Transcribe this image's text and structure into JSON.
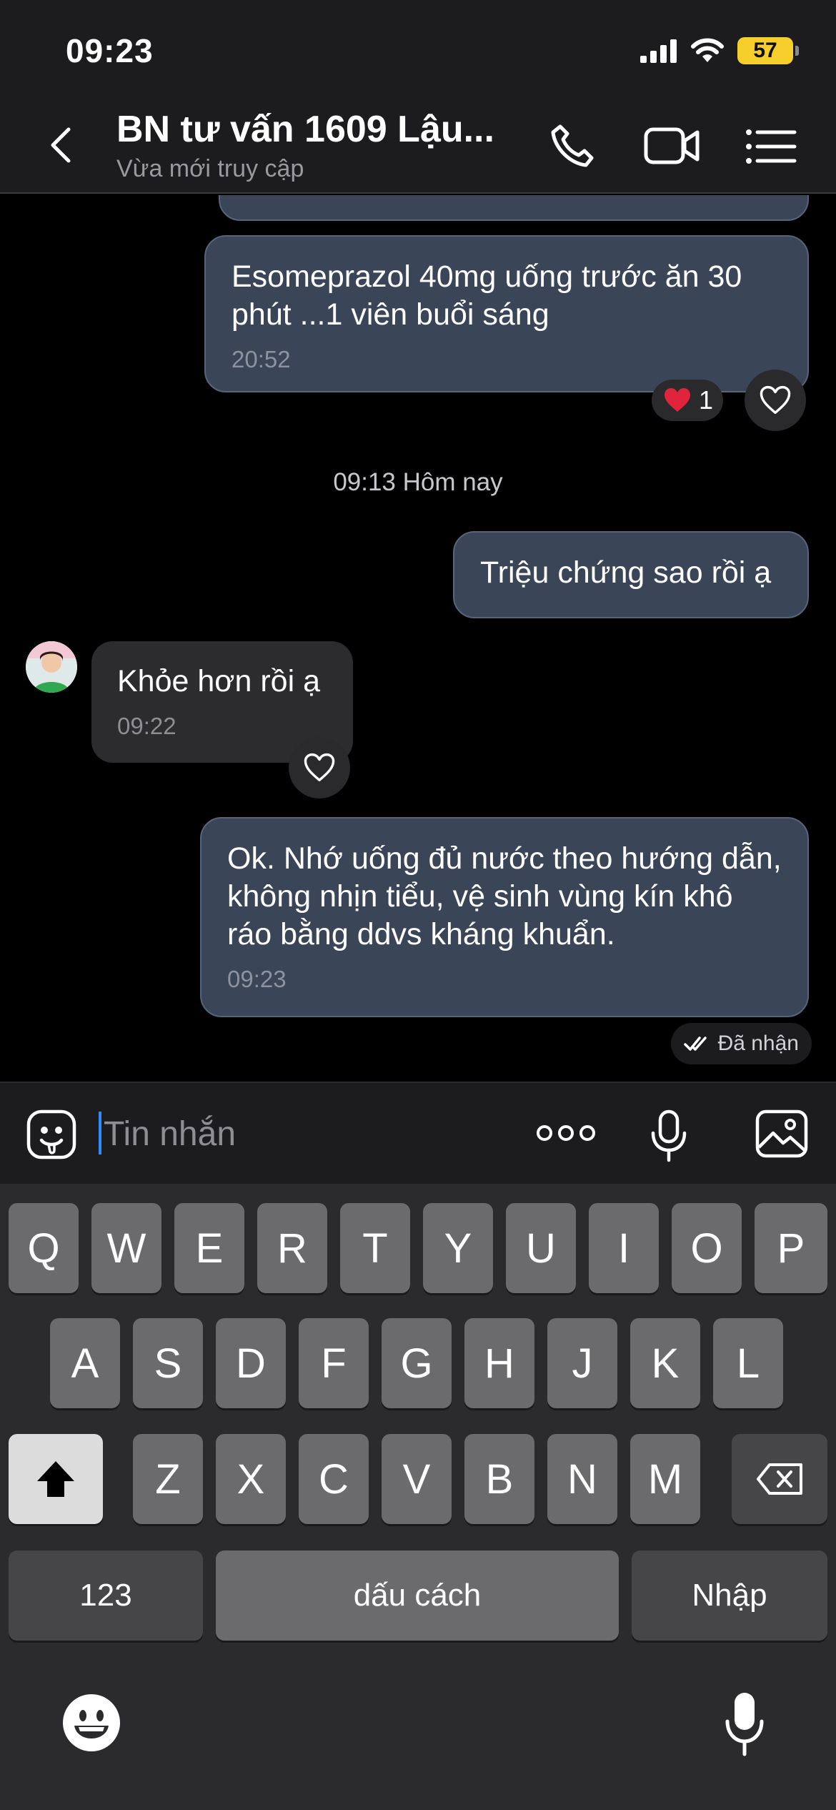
{
  "status_bar": {
    "time": "09:23",
    "battery": "57"
  },
  "header": {
    "title": "BN tư vấn 1609 Lậu...",
    "subtitle": "Vừa mới truy cập",
    "icons": [
      "back-icon",
      "phone-icon",
      "video-call-icon",
      "menu-list-icon"
    ]
  },
  "messages": [
    {
      "id": "m1",
      "direction": "out",
      "text": "Esomeprazol 40mg uống trước ăn 30 phút ...1 viên buổi sáng",
      "time": "20:52",
      "reaction_count": "1"
    },
    {
      "id": "m2",
      "direction": "out",
      "text": "Triệu chứng sao rồi ạ"
    },
    {
      "id": "m3",
      "direction": "in",
      "text": "Khỏe hơn rồi ạ",
      "time": "09:22"
    },
    {
      "id": "m4",
      "direction": "out",
      "text": "Ok. Nhớ uống đủ nước theo hướng dẫn, không nhịn tiểu, vệ sinh vùng kín khô ráo bằng ddvs kháng khuẩn.",
      "time": "09:23"
    }
  ],
  "date_separator": "09:13 Hôm nay",
  "delivery_status": "Đã nhận",
  "input": {
    "placeholder": "Tin nhắn"
  },
  "keyboard": {
    "row1": [
      "Q",
      "W",
      "E",
      "R",
      "T",
      "Y",
      "U",
      "I",
      "O",
      "P"
    ],
    "row2": [
      "A",
      "S",
      "D",
      "F",
      "G",
      "H",
      "J",
      "K",
      "L"
    ],
    "row3": [
      "Z",
      "X",
      "C",
      "V",
      "B",
      "N",
      "M"
    ],
    "numbers_key": "123",
    "space_key": "dấu cách",
    "return_key": "Nhập"
  },
  "colors": {
    "outgoing_bubble": "#3a4658",
    "incoming_bubble": "#2c2c2e",
    "battery": "#f6cf2c",
    "heart": "#e0243b"
  }
}
